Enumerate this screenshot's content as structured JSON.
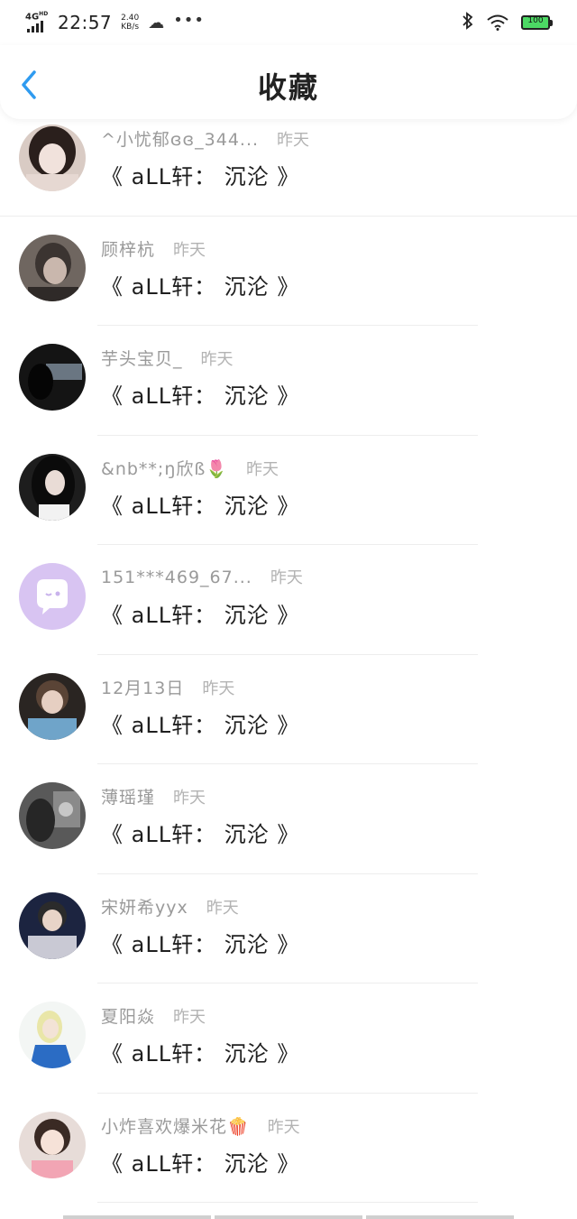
{
  "status_bar": {
    "network": "4G",
    "network_sup": "HD",
    "time": "22:57",
    "speed_value": "2.40",
    "speed_unit": "KB/s",
    "battery": "100"
  },
  "header": {
    "title": "收藏",
    "back_icon": "chevron-left-icon",
    "accent_color": "#2f9bf0"
  },
  "list": [
    {
      "name": "^小忧郁ɞɞ_344...",
      "time": "昨天",
      "title": "《 aLL轩： 沉沦 》",
      "avatar": "photo"
    },
    {
      "name": "顾梓杭",
      "time": "昨天",
      "title": "《 aLL轩： 沉沦 》",
      "avatar": "photo"
    },
    {
      "name": "芋头宝贝_",
      "time": "昨天",
      "title": "《 aLL轩： 沉沦 》",
      "avatar": "photo"
    },
    {
      "name": "&nb**;ŋ欣ß🌷",
      "time": "昨天",
      "title": "《 aLL轩： 沉沦 》",
      "avatar": "photo"
    },
    {
      "name": "151***469_67...",
      "time": "昨天",
      "title": "《 aLL轩： 沉沦 》",
      "avatar": "default-chat-icon"
    },
    {
      "name": "12月13日",
      "time": "昨天",
      "title": "《 aLL轩： 沉沦 》",
      "avatar": "photo"
    },
    {
      "name": "薄瑶瑾",
      "time": "昨天",
      "title": "《 aLL轩： 沉沦 》",
      "avatar": "photo"
    },
    {
      "name": "宋妍希yyx",
      "time": "昨天",
      "title": "《 aLL轩： 沉沦 》",
      "avatar": "photo"
    },
    {
      "name": "夏阳焱",
      "time": "昨天",
      "title": "《 aLL轩： 沉沦 》",
      "avatar": "photo"
    },
    {
      "name": "小炸喜欢爆米花🍿",
      "time": "昨天",
      "title": "《 aLL轩： 沉沦 》",
      "avatar": "photo"
    }
  ]
}
